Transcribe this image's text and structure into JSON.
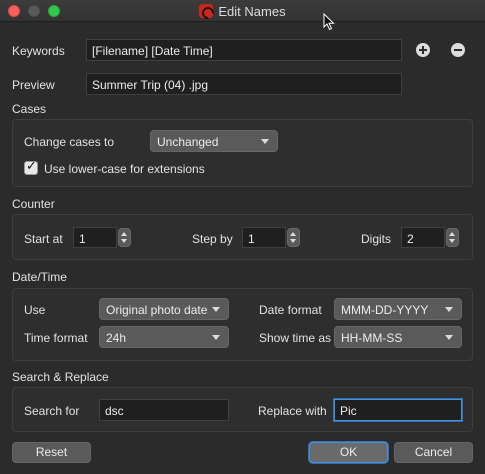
{
  "window": {
    "title": "Edit Names"
  },
  "keywords": {
    "label": "Keywords",
    "value": "[Filename] [Date Time]"
  },
  "preview": {
    "label": "Preview",
    "value": "Summer Trip (04) .jpg"
  },
  "cases": {
    "heading": "Cases",
    "change_label": "Change cases to",
    "change_value": "Unchanged",
    "lowercase_ext_label": "Use lower-case for extensions",
    "lowercase_ext_checked": true
  },
  "counter": {
    "heading": "Counter",
    "start_label": "Start at",
    "start_value": "1",
    "step_label": "Step by",
    "step_value": "1",
    "digits_label": "Digits",
    "digits_value": "2"
  },
  "datetime": {
    "heading": "Date/Time",
    "use_label": "Use",
    "use_value": "Original photo date",
    "date_format_label": "Date format",
    "date_format_value": "MMM-DD-YYYY",
    "time_format_label": "Time format",
    "time_format_value": "24h",
    "show_time_label": "Show time as",
    "show_time_value": "HH-MM-SS"
  },
  "search_replace": {
    "heading": "Search & Replace",
    "search_label": "Search for",
    "search_value": "dsc",
    "replace_label": "Replace with",
    "replace_value": "Pic"
  },
  "buttons": {
    "reset": "Reset",
    "ok": "OK",
    "cancel": "Cancel"
  },
  "colors": {
    "background": "#2b2b2b",
    "focus_ring": "#4a90d9",
    "close": "#fc605c",
    "zoom": "#34c84a"
  }
}
